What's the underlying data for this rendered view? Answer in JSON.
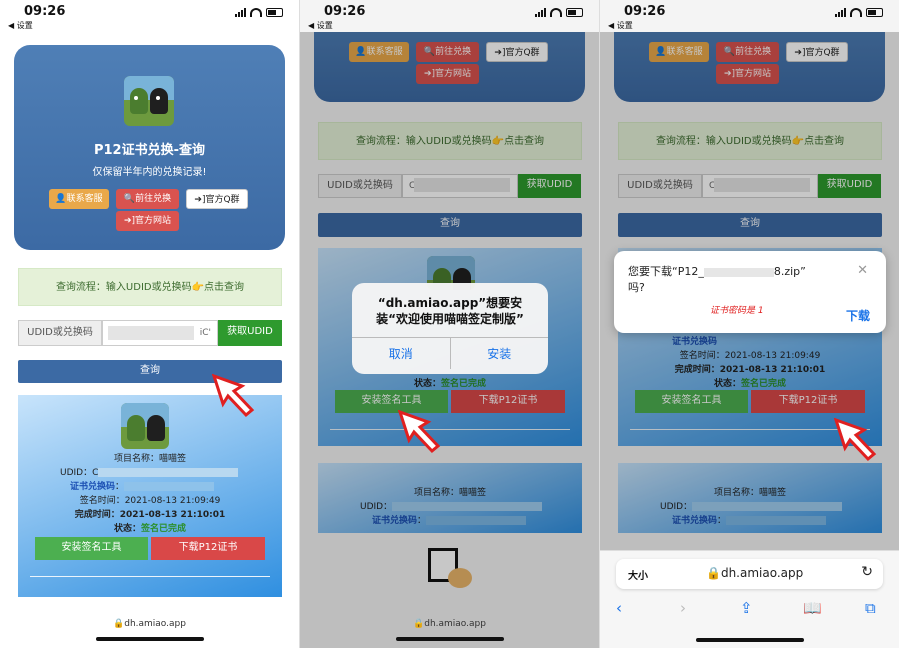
{
  "status": {
    "time": "09:26",
    "back": "◀ 设置"
  },
  "page": {
    "title": "P12证书兑换-查询",
    "subtitle": "仅保留半年内的兑换记录!",
    "buttons": {
      "contact": "👤联系客服",
      "goto_redeem": "🔍前往兑换",
      "qq_group": "➔]官方Q群",
      "official_site": "➔]官方网站"
    },
    "tip": "查询流程：输入UDID或兑换码👉点击查询",
    "field_label": "UDID或兑换码",
    "input_value_p1": "iC'",
    "input_value": "C",
    "get_udid": "获取UDID",
    "query": "查询",
    "result": {
      "project_label": "项目名称：",
      "project_value": "喵喵签",
      "udid_label": "UDID：",
      "udid_value_p1": "C",
      "code_label": "证书兑换码",
      "code_sep": "：",
      "sign_time_label": "签名时间：",
      "sign_time": "2021-08-13 21:09:49",
      "done_time_label": "完成时间：",
      "done_time": "2021-08-13 21:10:01",
      "state_label": "状态：",
      "state": "签名已完成",
      "install_tool": "安装签名工具",
      "download_p12": "下载P12证书"
    }
  },
  "browser": {
    "url": "dh.amiao.app",
    "text_size": "大小"
  },
  "install_dialog": {
    "message": "“dh.amiao.app”想要安装“欢迎使用喵喵签定制版”",
    "cancel": "取消",
    "install": "安装"
  },
  "download_dialog": {
    "message_prefix": "您要下载“P12_",
    "message_suffix": "8.zip”",
    "message_line2": "吗?",
    "close": "✕",
    "download": "下载",
    "handwritten": "证书密码是 1"
  },
  "panel2_result": {
    "project_label": "项目名称：",
    "project_value": "喵喵签",
    "udid_label": "UDID：",
    "code_label": "证书兑换码",
    "code_sep": "：",
    "sign_time_label": "签名时间：",
    "sign_time": "2021-08-13 21:09:49",
    "done_time_label": "完成时间：",
    "done_time": "2021-08-13 21:10:01",
    "state_label": "状态：",
    "state": "签名已完成"
  },
  "colors": {
    "accent_blue": "#3c6aa4",
    "green": "#2e9a2e",
    "red": "#d9534f",
    "orange": "#e9a84a"
  }
}
